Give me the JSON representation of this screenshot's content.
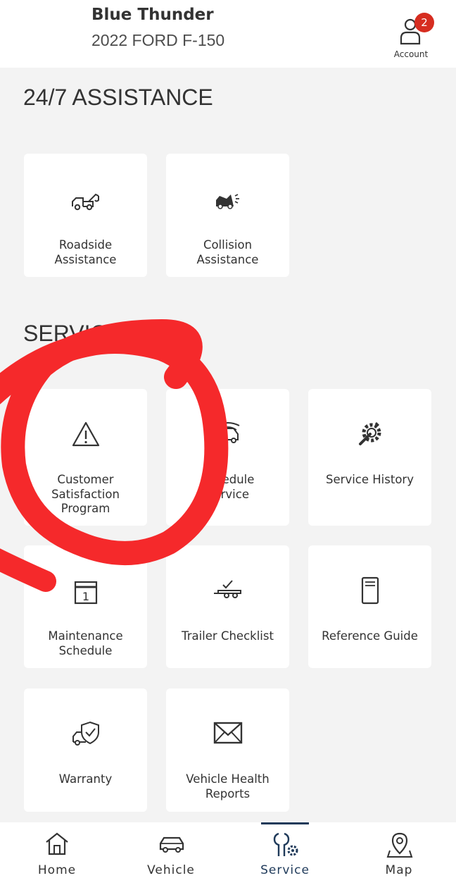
{
  "header": {
    "vehicle_name": "Blue Thunder",
    "vehicle_model": "2022 FORD F-150",
    "account_label": "Account",
    "account_badge": "2",
    "badge_color": "#d62d20"
  },
  "sections": {
    "assistance_title": "24/7 ASSISTANCE",
    "service_title": "SERVICE"
  },
  "tiles": {
    "roadside": {
      "label": "Roadside\nAssistance",
      "icon": "tow-truck-icon"
    },
    "collision": {
      "label": "Collision\nAssistance",
      "icon": "collision-car-icon"
    },
    "csp": {
      "label": "Customer\nSatisfaction\nProgram",
      "icon": "warning-triangle-icon"
    },
    "schedule": {
      "label": "Schedule\nService",
      "icon": "car-service-icon"
    },
    "history": {
      "label": "Service History",
      "icon": "wrench-gear-icon"
    },
    "maintenance": {
      "label": "Maintenance\nSchedule",
      "icon": "calendar-icon"
    },
    "trailer": {
      "label": "Trailer Checklist",
      "icon": "trailer-check-icon"
    },
    "reference": {
      "label": "Reference Guide",
      "icon": "book-icon"
    },
    "warranty": {
      "label": "Warranty",
      "icon": "car-shield-icon"
    },
    "vhr": {
      "label": "Vehicle Health\nReports",
      "icon": "envelope-icon"
    }
  },
  "nav": {
    "home": "Home",
    "vehicle": "Vehicle",
    "service": "Service",
    "map": "Map",
    "active": "Service",
    "active_color": "#1f3a5a"
  },
  "annotation": {
    "color": "#f5292b",
    "shape": "hand-drawn circle around Customer Satisfaction Program"
  }
}
